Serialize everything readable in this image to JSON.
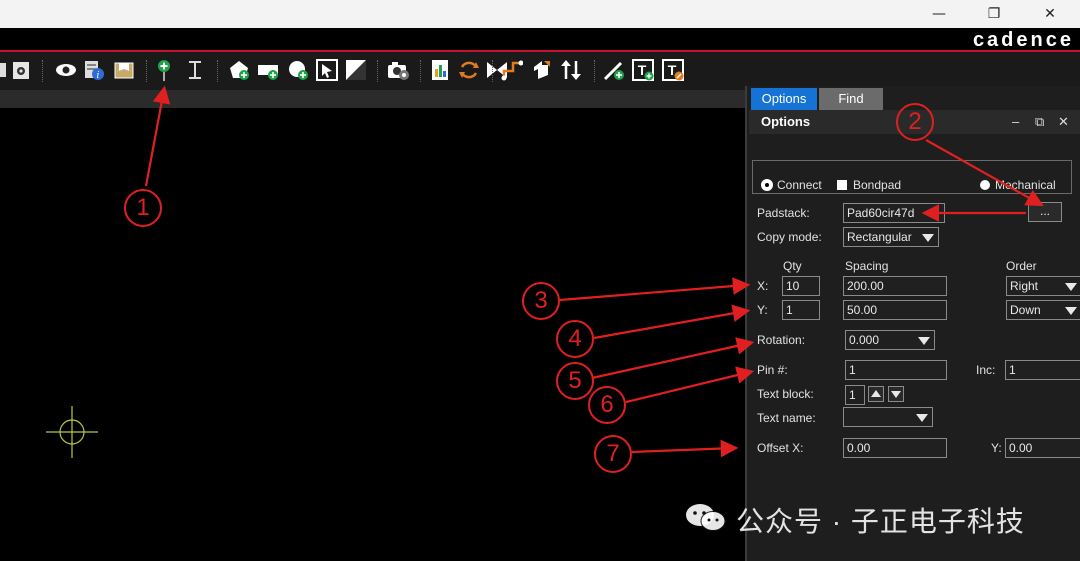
{
  "window": {
    "brand": "cadence",
    "minimize_glyph": "—",
    "restore_glyph": "❐",
    "close_glyph": "✕"
  },
  "toolbar": {
    "icons": [
      "open-icon",
      "settings-icon",
      "visibility-icon",
      "info-icon",
      "package-icon",
      "add-pin-icon",
      "text-cursor-icon",
      "add-polygon-icon",
      "add-rect-icon",
      "add-circle-icon",
      "select-icon",
      "fill-icon",
      "camera-settings-icon",
      "report-icon",
      "swap-icon",
      "bowtie-icon",
      "route-icon",
      "move-icon",
      "swap-arrows-icon",
      "add-line-icon",
      "add-text-icon",
      "edit-text-icon"
    ]
  },
  "panel": {
    "tabs": {
      "options": "Options",
      "find": "Find"
    },
    "header": {
      "title": "Options",
      "minimize": "–",
      "float": "⧉",
      "close": "✕"
    },
    "pin_type": {
      "connect": "Connect",
      "bondpad": "Bondpad",
      "mechanical": "Mechanical",
      "selected": "Connect"
    },
    "padstack": {
      "label": "Padstack:",
      "value": "Pad60cir47d",
      "browse": "..."
    },
    "copy_mode": {
      "label": "Copy mode:",
      "value": "Rectangular"
    },
    "columns": {
      "qty": "Qty",
      "spacing": "Spacing",
      "order": "Order"
    },
    "x_row": {
      "label": "X:",
      "qty": "10",
      "spacing": "200.00",
      "order": "Right"
    },
    "y_row": {
      "label": "Y:",
      "qty": "1",
      "spacing": "50.00",
      "order": "Down"
    },
    "rotation": {
      "label": "Rotation:",
      "value": "0.000"
    },
    "pin_number": {
      "label": "Pin #:",
      "value": "1",
      "inc_label": "Inc:",
      "inc_value": "1"
    },
    "text_block": {
      "label": "Text block:",
      "value": "1"
    },
    "text_name": {
      "label": "Text name:",
      "value": ""
    },
    "offset": {
      "x_label": "Offset X:",
      "x_value": "0.00",
      "y_label": "Y:",
      "y_value": "0.00"
    }
  },
  "annotations": [
    "1",
    "2",
    "3",
    "4",
    "5",
    "6",
    "7"
  ],
  "watermark": {
    "text": "公众号 · 子正电子科技"
  },
  "colors": {
    "accent_tab": "#1473d4",
    "annotation": "#e02020",
    "brand_line": "#c8102e",
    "crosshair": "#b8c64a"
  }
}
